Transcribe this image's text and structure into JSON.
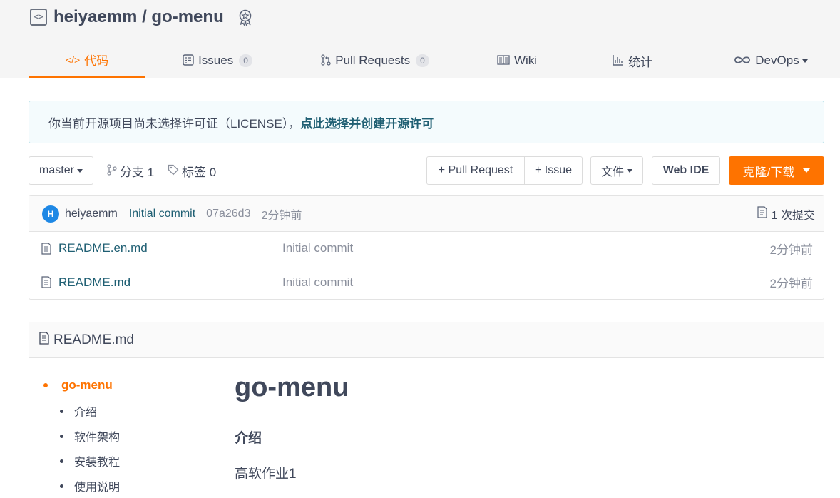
{
  "repo": {
    "owner": "heiyaemm",
    "name": "go-menu",
    "full": "heiyaemm / go-menu"
  },
  "tabs": [
    {
      "label": "代码",
      "icon": "code-icon",
      "active": true
    },
    {
      "label": "Issues",
      "icon": "issues-icon",
      "count": "0"
    },
    {
      "label": "Pull Requests",
      "icon": "pull-request-icon",
      "count": "0"
    },
    {
      "label": "Wiki",
      "icon": "book-icon"
    },
    {
      "label": "统计",
      "icon": "bar-chart-icon"
    },
    {
      "label": "DevOps",
      "icon": "infinity-icon"
    }
  ],
  "notice": {
    "text": "你当前开源项目尚未选择许可证（LICENSE），",
    "link": "点此选择并创建开源许可"
  },
  "toolbar": {
    "branch": "master",
    "branches": "分支 1",
    "tags": "标签 0",
    "new_pr": "+ Pull Request",
    "new_issue": "+ Issue",
    "file": "文件",
    "web_ide": "Web IDE",
    "clone": "克隆/下载"
  },
  "commit": {
    "avatar_letter": "H",
    "author": "heiyaemm",
    "message": "Initial commit",
    "sha": "07a26d3",
    "time": "2分钟前",
    "count": "1 次提交"
  },
  "files": [
    {
      "name": "README.en.md",
      "message": "Initial commit",
      "time": "2分钟前"
    },
    {
      "name": "README.md",
      "message": "Initial commit",
      "time": "2分钟前"
    }
  ],
  "readme": {
    "filename": "README.md",
    "toc_top": "go-menu",
    "toc": [
      "介绍",
      "软件架构",
      "安装教程",
      "使用说明"
    ],
    "title": "go-menu",
    "section": "介绍",
    "text": "高软作业1"
  },
  "colors": {
    "accent": "#fe7300",
    "link": "#1f5f73",
    "muted": "#8a8f9c"
  }
}
